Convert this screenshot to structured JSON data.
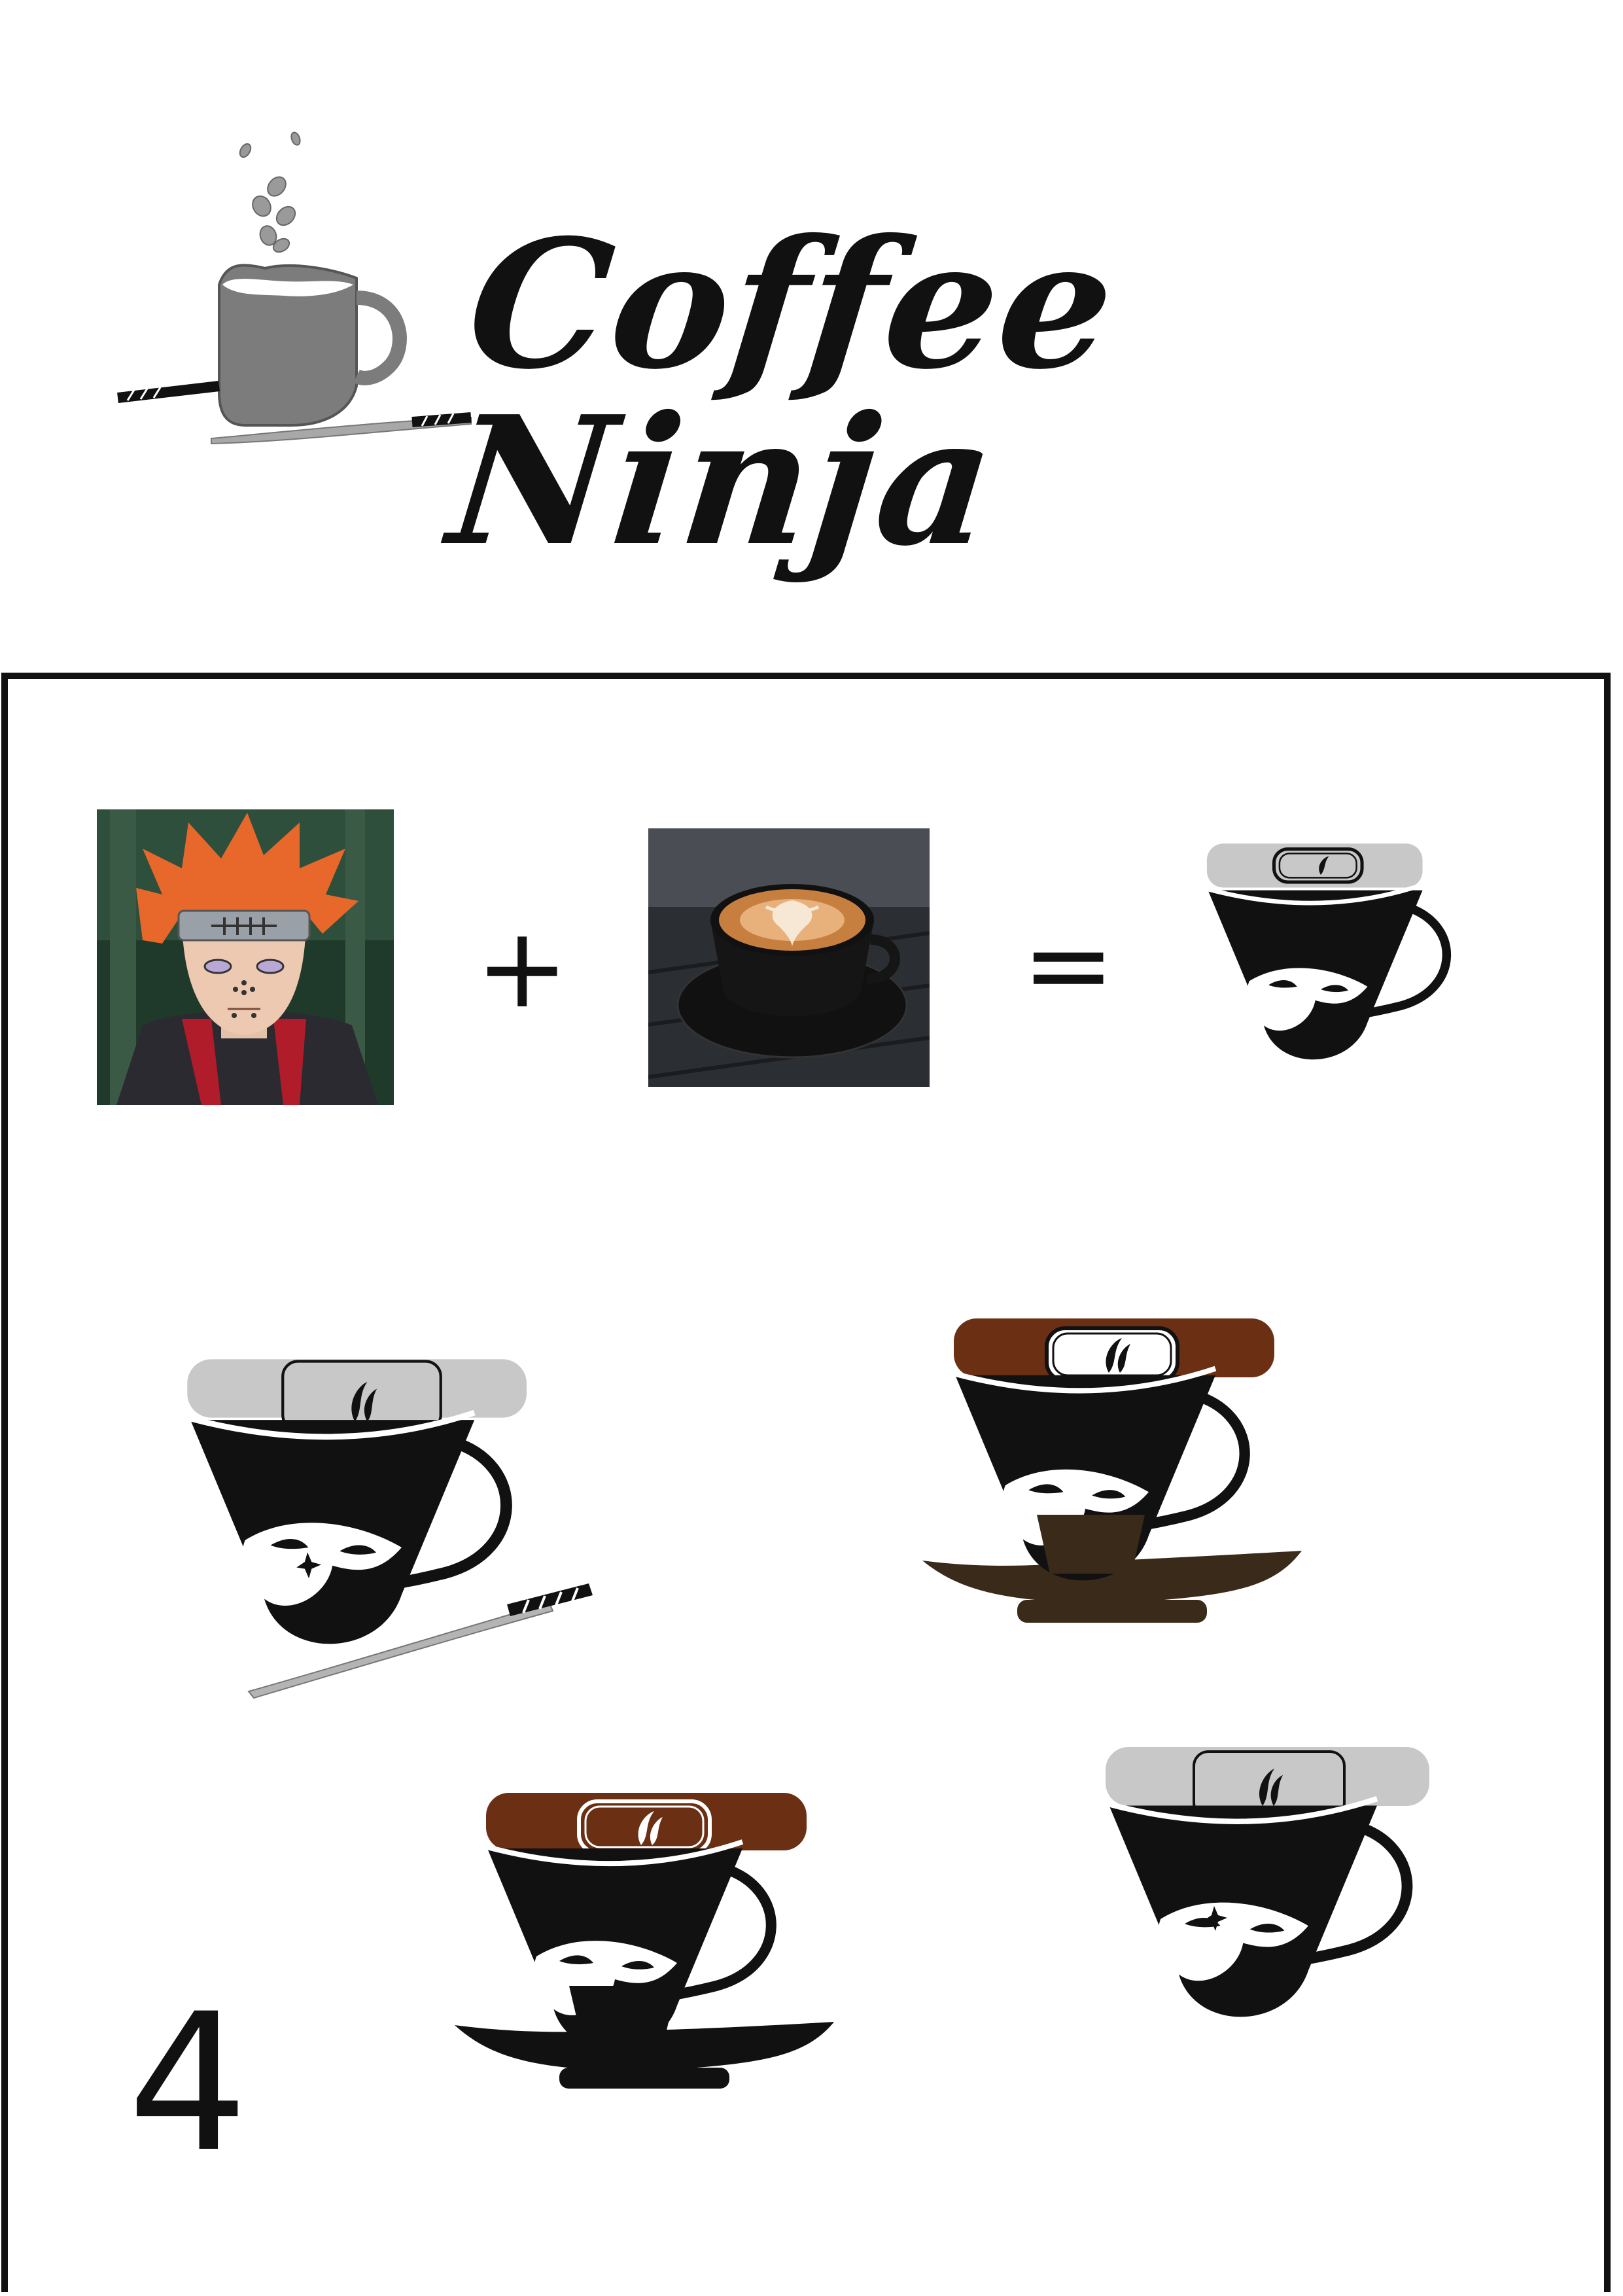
{
  "header": {
    "brand_name": "Coffee Ninja",
    "logo_icon": "coffee-cup-with-katana-icon"
  },
  "equation": {
    "plus": "+",
    "equals": "=",
    "inputs": [
      "ninja-character-portrait",
      "latte-art-cup-photo"
    ],
    "result_icon": "ninja-coffee-cup-logo-icon"
  },
  "variations": [
    {
      "name": "gray-headband-with-katana",
      "band_color": "#c8c8c8"
    },
    {
      "name": "brown-headband-with-brown-saucer",
      "band_color": "#6b2f14"
    },
    {
      "name": "brown-headband-with-black-saucer",
      "band_color": "#6b2f14"
    },
    {
      "name": "gray-headband-plain",
      "band_color": "#c8c8c8"
    }
  ],
  "colors": {
    "black": "#111111",
    "gray_band": "#c8c8c8",
    "brown_band": "#6b2f14",
    "brown_saucer": "#3a2a1a",
    "logo_gray": "#808080"
  },
  "page_number": "4"
}
